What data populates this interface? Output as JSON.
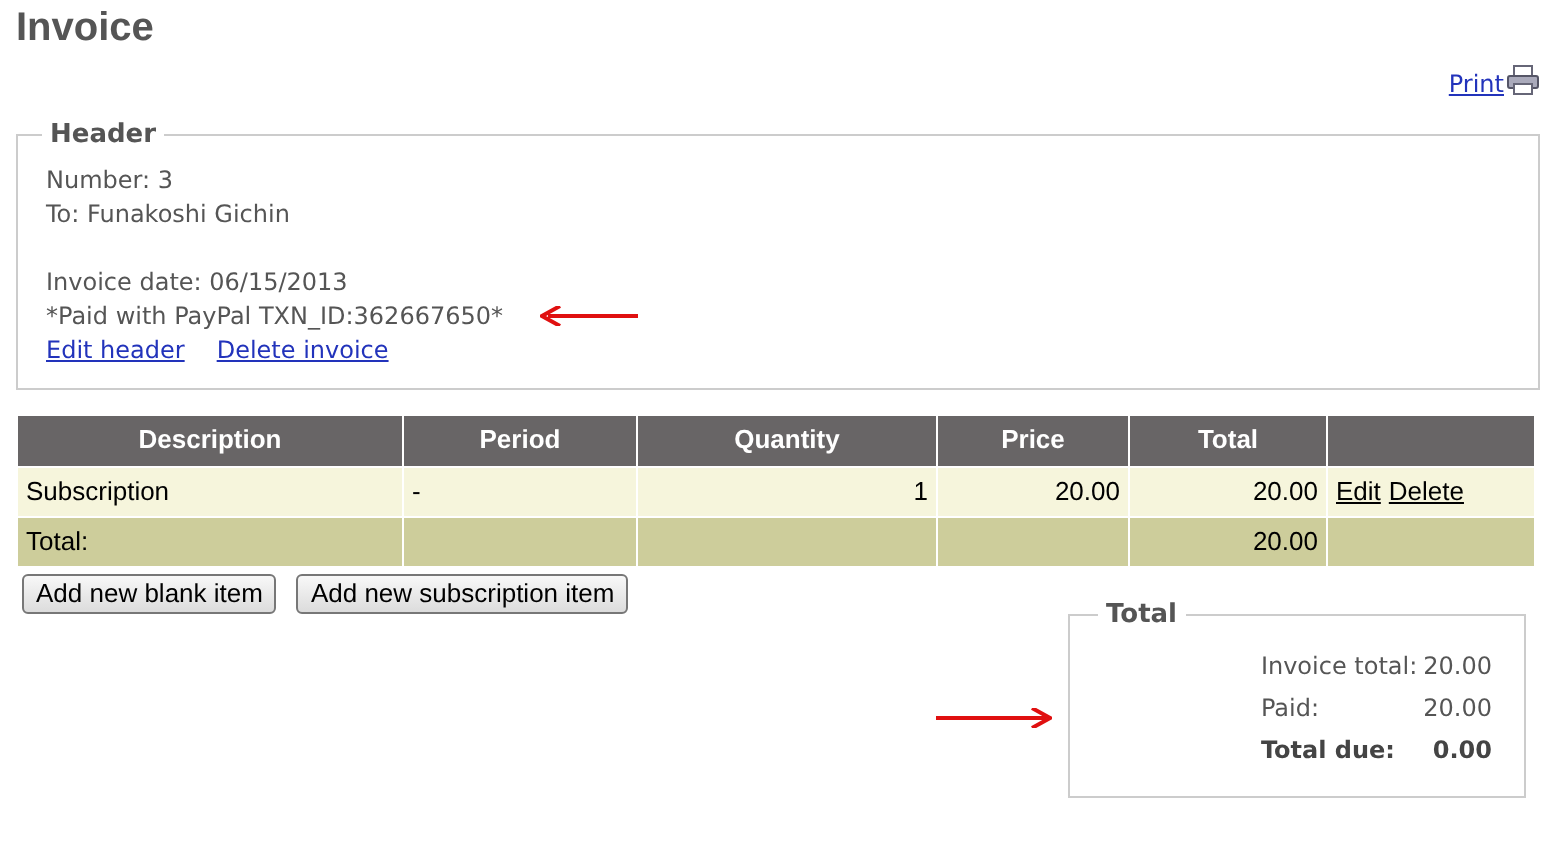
{
  "title": "Invoice",
  "print_link": "Print",
  "header": {
    "legend": "Header",
    "number": "Number: 3",
    "to": "To: Funakoshi Gichin",
    "invoice_date": "Invoice date: 06/15/2013",
    "payment_note": "*Paid with PayPal TXN_ID:362667650*",
    "actions": [
      "Edit header",
      "Delete invoice"
    ]
  },
  "table": {
    "columns": [
      "Description",
      "Period",
      "Quantity",
      "Price",
      "Total"
    ],
    "rows": [
      {
        "cells": [
          "Subscription",
          "-",
          "1",
          "20.00",
          "20.00"
        ],
        "actions": [
          "Edit",
          "Delete"
        ]
      }
    ],
    "total_row": {
      "label": "Total:",
      "total": "20.00"
    }
  },
  "buttons": [
    "Add new blank item",
    "Add new subscription item"
  ],
  "totals": {
    "legend": "Total",
    "rows": [
      {
        "label": "Invoice total:",
        "value": "20.00",
        "bold": false
      },
      {
        "label": "Paid:",
        "value": "20.00",
        "bold": false
      },
      {
        "label": "Total due:",
        "value": "0.00",
        "bold": true
      }
    ]
  }
}
